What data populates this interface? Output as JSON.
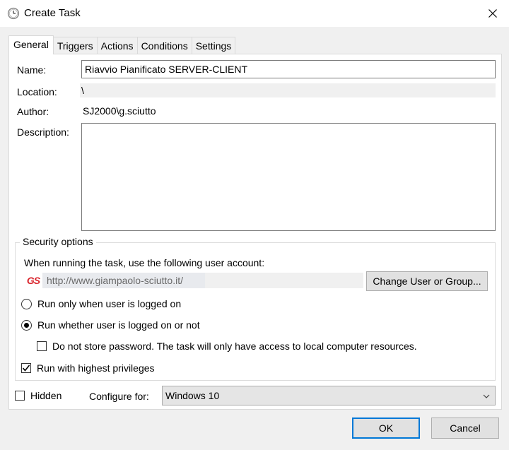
{
  "window": {
    "title": "Create Task",
    "icon": "clock-icon"
  },
  "tabs": [
    {
      "label": "General",
      "active": true
    },
    {
      "label": "Triggers",
      "active": false
    },
    {
      "label": "Actions",
      "active": false
    },
    {
      "label": "Conditions",
      "active": false
    },
    {
      "label": "Settings",
      "active": false
    }
  ],
  "general": {
    "name_label": "Name:",
    "name_value": "Riavvio Pianificato SERVER-CLIENT",
    "location_label": "Location:",
    "location_value": "\\",
    "author_label": "Author:",
    "author_value": "SJ2000\\g.sciutto",
    "description_label": "Description:",
    "description_value": ""
  },
  "security": {
    "legend": "Security options",
    "account_prompt": "When running the task, use the following user account:",
    "account_logo": "GS",
    "account_value": "http://www.giampaolo-sciutto.it/",
    "change_button": "Change User or Group...",
    "radio_logged_on": "Run only when user is logged on",
    "radio_whether": "Run whether user is logged on or not",
    "radio_selected": "whether",
    "no_store_password": "Do not store password.  The task will only have access to local computer resources.",
    "no_store_password_checked": false,
    "highest_privileges": "Run with highest privileges",
    "highest_privileges_checked": true
  },
  "footer": {
    "hidden_label": "Hidden",
    "hidden_checked": false,
    "configure_label": "Configure for:",
    "configure_value": "Windows 10"
  },
  "buttons": {
    "ok": "OK",
    "cancel": "Cancel"
  },
  "colors": {
    "accent": "#0078d7",
    "logo_red": "#d9232b"
  }
}
